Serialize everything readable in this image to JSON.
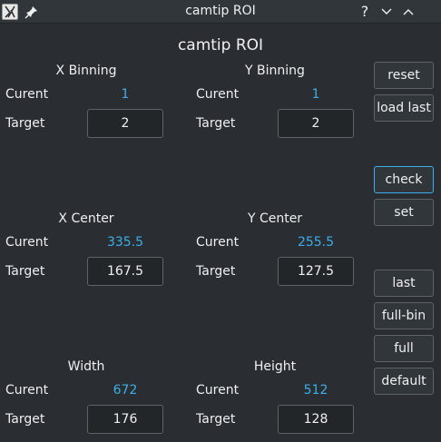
{
  "window": {
    "title": "camtip ROI",
    "help_glyph": "?"
  },
  "heading": "camtip ROI",
  "labels": {
    "current": "Curent",
    "target": "Target"
  },
  "groups": {
    "x_binning": {
      "title": "X Binning",
      "current": "1",
      "target": "2"
    },
    "y_binning": {
      "title": "Y Binning",
      "current": "1",
      "target": "2"
    },
    "x_center": {
      "title": "X Center",
      "current": "335.5",
      "target": "167.5"
    },
    "y_center": {
      "title": "Y Center",
      "current": "255.5",
      "target": "127.5"
    },
    "width": {
      "title": "Width",
      "current": "672",
      "target": "176"
    },
    "height": {
      "title": "Height",
      "current": "512",
      "target": "128"
    }
  },
  "buttons": {
    "reset": "reset",
    "load_last": "load last",
    "check": "check",
    "set": "set",
    "last": "last",
    "full_bin": "full-bin",
    "full": "full",
    "default": "default"
  },
  "colors": {
    "background": "#2a2e32",
    "accent": "#3daee9",
    "field_bg": "#232629"
  },
  "icons": [
    "app-icon",
    "pin-icon",
    "help-icon",
    "minimize-icon",
    "maximize-icon"
  ]
}
